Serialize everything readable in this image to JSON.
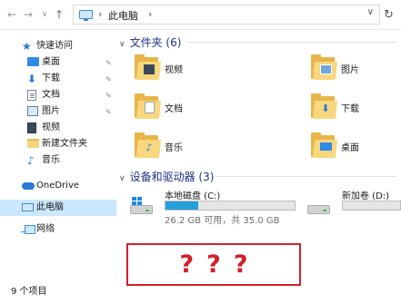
{
  "navigation": {
    "back_glyph": "←",
    "forward_glyph": "→",
    "recent_glyph": "∨",
    "up_glyph": "↑",
    "address_path": "此电脑",
    "address_separator": "›",
    "address_dropdown_glyph": "∨",
    "refresh_glyph": "↻"
  },
  "sidebar": {
    "items": [
      {
        "label": "快速访问",
        "icon": "star-icon"
      },
      {
        "label": "桌面",
        "icon": "desktop-icon",
        "pinned": true
      },
      {
        "label": "下载",
        "icon": "download-icon",
        "pinned": true
      },
      {
        "label": "文档",
        "icon": "document-icon",
        "pinned": true
      },
      {
        "label": "图片",
        "icon": "picture-icon",
        "pinned": true
      },
      {
        "label": "视频",
        "icon": "video-icon"
      },
      {
        "label": "新建文件夹",
        "icon": "folder-icon"
      },
      {
        "label": "音乐",
        "icon": "music-icon"
      },
      {
        "label": "OneDrive",
        "icon": "cloud-icon"
      },
      {
        "label": "此电脑",
        "icon": "computer-icon",
        "selected": true
      },
      {
        "label": "网络",
        "icon": "network-icon"
      }
    ],
    "pin_glyph": "✎"
  },
  "status_bar": {
    "item_count": "9 个项目"
  },
  "folders_group": {
    "header": "文件夹 (6)",
    "chevron": "∨",
    "items": [
      {
        "label": "视频",
        "icon": "video-folder-icon"
      },
      {
        "label": "图片",
        "icon": "pictures-folder-icon"
      },
      {
        "label": "文档",
        "icon": "documents-folder-icon"
      },
      {
        "label": "下载",
        "icon": "downloads-folder-icon"
      },
      {
        "label": "音乐",
        "icon": "music-folder-icon"
      },
      {
        "label": "桌面",
        "icon": "desktop-folder-icon"
      }
    ]
  },
  "drives_group": {
    "header": "设备和驱动器 (3)",
    "chevron": "∨",
    "items": [
      {
        "name": "本地磁盘 (C:)",
        "free_text": "26.2 GB 可用，共 35.0 GB",
        "used_fraction": 0.25,
        "icon": "windows-drive-icon"
      },
      {
        "name": "新加卷 (D:)",
        "free_text": "",
        "used_fraction": 0.0,
        "icon": "drive-icon"
      }
    ]
  },
  "annotation": {
    "text": "???"
  },
  "colors": {
    "accent": "#26a0da",
    "selected_bg": "#cce8ff",
    "header_text": "#1e3287",
    "annotation": "#d11f2b",
    "folder": "#f9d77e"
  }
}
